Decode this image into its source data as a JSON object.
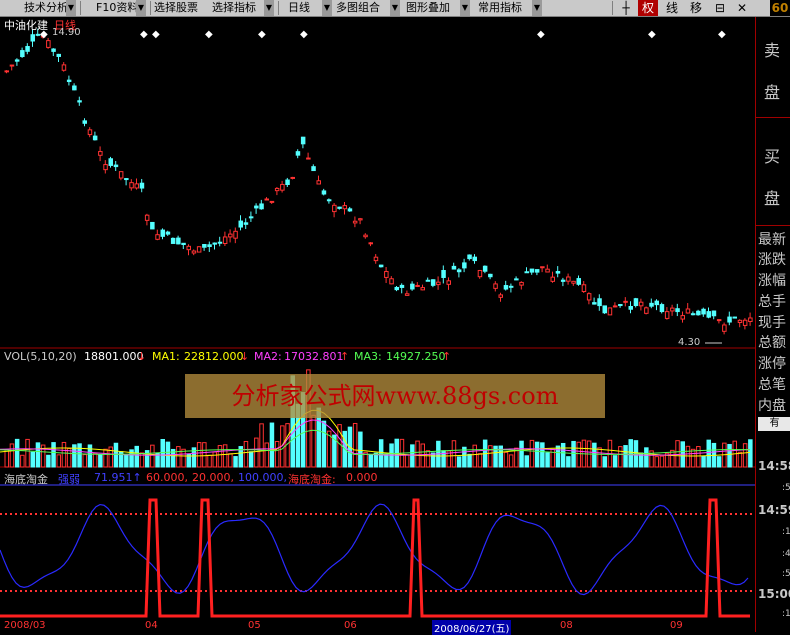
{
  "toolbar": {
    "buttons": [
      {
        "label": "技术分析"
      },
      {
        "label": "F10资料"
      },
      {
        "label": "选择股票"
      },
      {
        "label": "选择指标"
      },
      {
        "label": "日线"
      },
      {
        "label": "多图组合"
      },
      {
        "label": "图形叠加"
      },
      {
        "label": "常用指标"
      }
    ],
    "icons": [
      {
        "name": "crosshair-icon",
        "glyph": "┼"
      },
      {
        "name": "quan-icon",
        "glyph": "权"
      },
      {
        "name": "line-icon",
        "glyph": "线"
      },
      {
        "name": "move-icon",
        "glyph": "移"
      },
      {
        "name": "window-icon",
        "glyph": "⊟"
      },
      {
        "name": "close-icon",
        "glyph": "✕"
      }
    ],
    "corner_text": "60"
  },
  "main": {
    "stock_name": "中油化建",
    "period": "日线",
    "high_label": "14.90",
    "low_label": "4.30",
    "colors": {
      "up": "#ff3232",
      "down": "#54ffff"
    }
  },
  "volume": {
    "title": "VOL(5,10,20)",
    "vol": "18801.000",
    "ma1_label": "MA1:",
    "ma1": "22812.000",
    "ma2_label": "MA2:",
    "ma2": "17032.801",
    "ma3_label": "MA3:",
    "ma3": "14927.250",
    "arrows": {
      "vol": "↓",
      "ma1": "↓",
      "ma2": "↑",
      "ma3": "↑"
    }
  },
  "indicator": {
    "name": "海底淘金",
    "l1": "强弱",
    "v1": "71.951↑",
    "v2": "60.000,",
    "v3": "20.000,",
    "v4": "100.000,",
    "l2": "海底淘金:",
    "v5": "0.000"
  },
  "watermark": "分析家公式网www.88gs.com",
  "sidebar": {
    "sell": [
      "卖",
      "盘"
    ],
    "buy": [
      "买",
      "盘"
    ],
    "items": [
      "最新",
      "涨跌",
      "涨幅",
      "总手",
      "现手",
      "总额",
      "涨停",
      "总笔",
      "内盘"
    ],
    "button": "有",
    "times": [
      "14:58",
      "14:59",
      "15:00"
    ],
    "small": [
      ":5",
      ":1",
      ":4",
      ":5",
      ":1"
    ]
  },
  "dates": [
    "2008/03",
    "04",
    "05",
    "06",
    "2008/06/27(五)",
    "08",
    "09"
  ]
}
